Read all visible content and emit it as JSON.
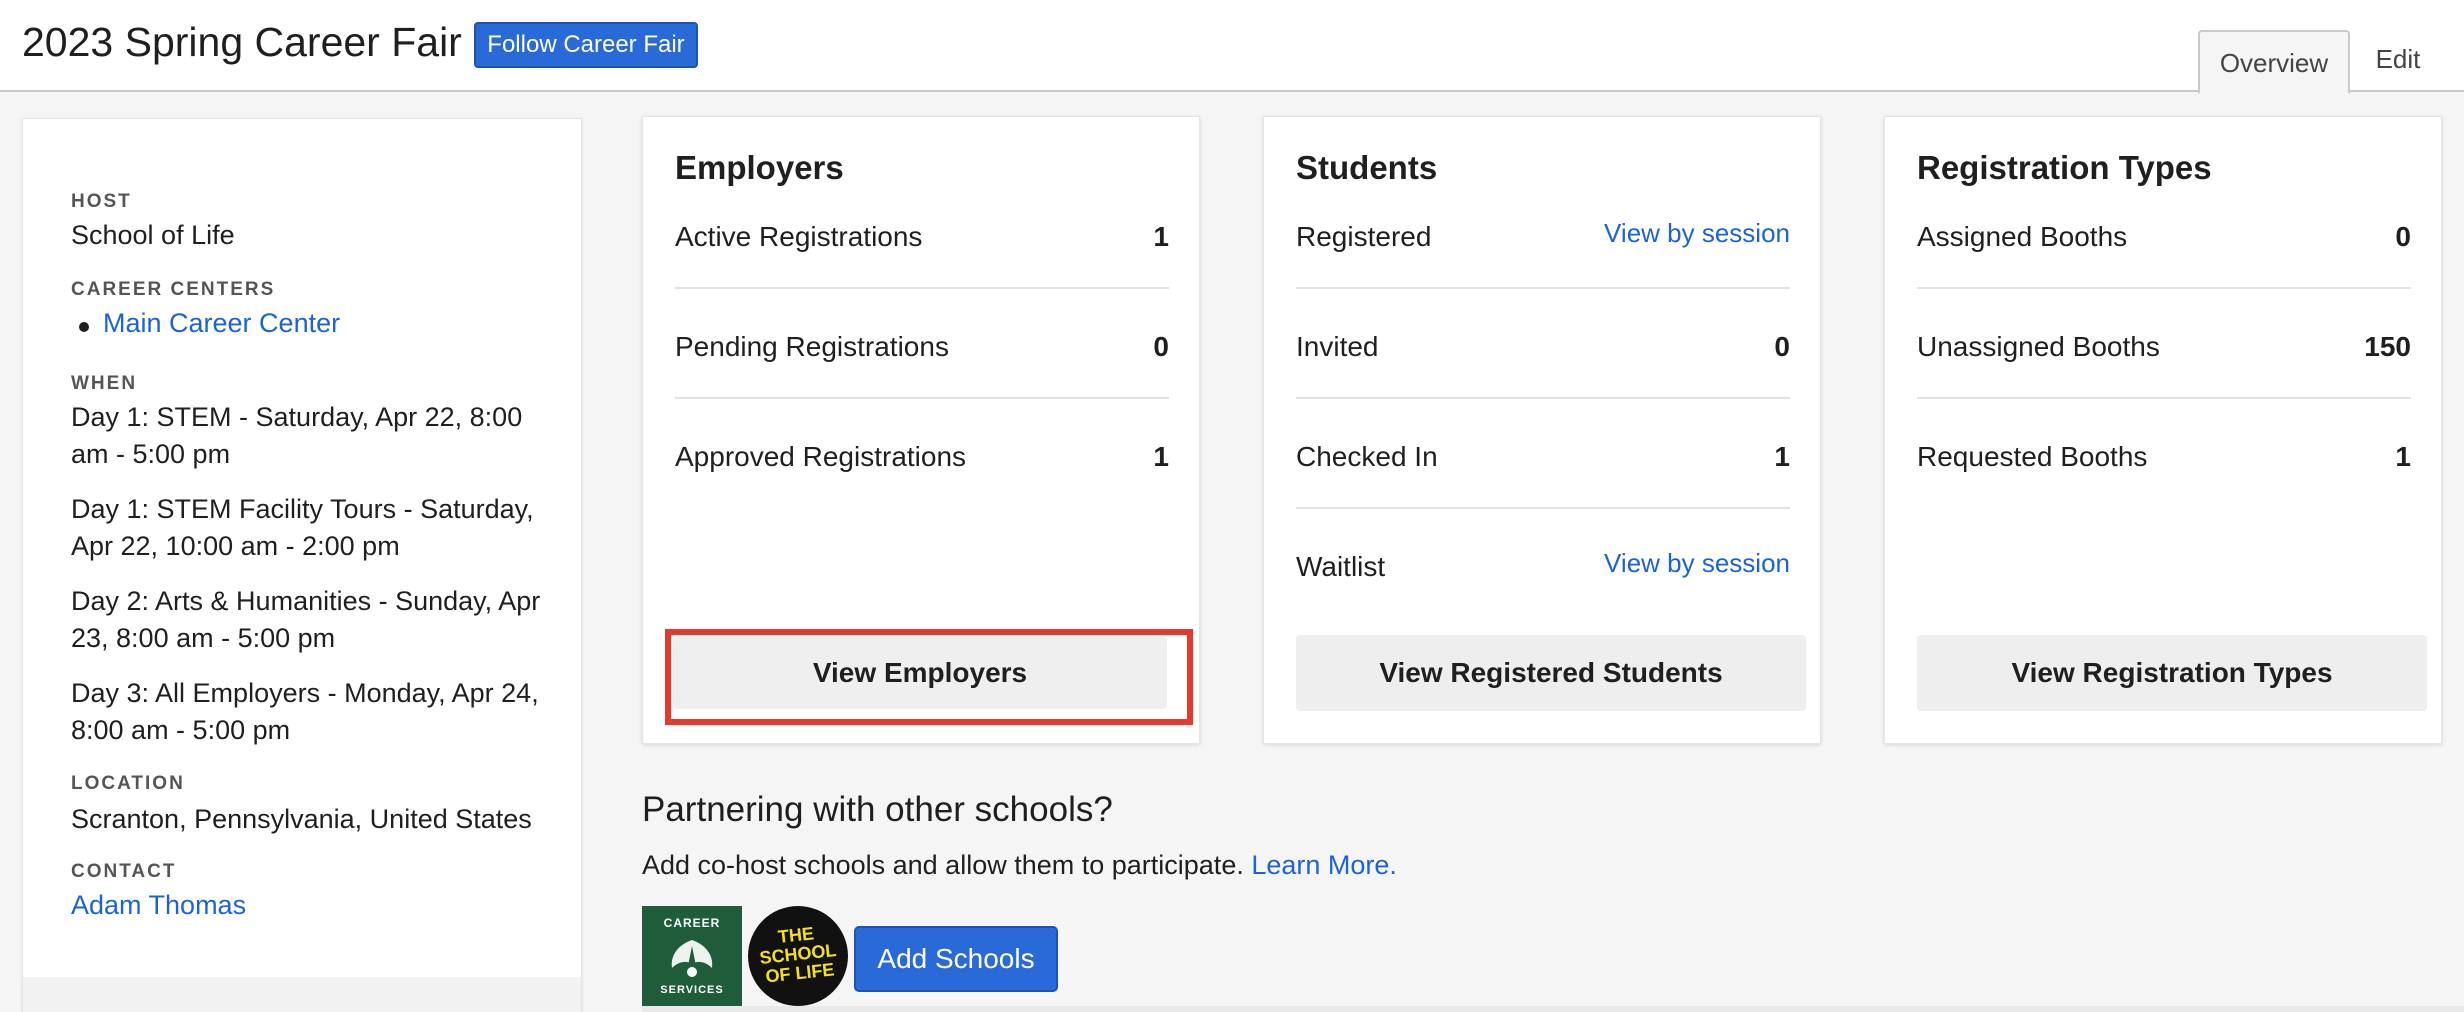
{
  "header": {
    "title": "2023 Spring Career Fair",
    "follow_label": "Follow Career Fair",
    "tabs": [
      {
        "label": "Overview",
        "active": true
      },
      {
        "label": "Edit",
        "active": false
      }
    ]
  },
  "info": {
    "host_label": "HOST",
    "host_value": "School of Life",
    "centers_label": "CAREER CENTERS",
    "centers": [
      "Main Career Center"
    ],
    "when_label": "WHEN",
    "when": [
      "Day 1: STEM - Saturday, Apr 22, 8:00 am - 5:00 pm",
      "Day 1: STEM Facility Tours - Saturday, Apr 22, 10:00 am - 2:00 pm",
      "Day 2: Arts & Humanities - Sunday, Apr 23, 8:00 am - 5:00 pm",
      "Day 3: All Employers - Monday, Apr 24, 8:00 am - 5:00 pm"
    ],
    "location_label": "LOCATION",
    "location_value": "Scranton, Pennsylvania, United States",
    "contact_label": "CONTACT",
    "contact_value": "Adam Thomas"
  },
  "employers": {
    "title": "Employers",
    "rows": [
      {
        "label": "Active Registrations",
        "value": "1"
      },
      {
        "label": "Pending Registrations",
        "value": "0"
      },
      {
        "label": "Approved Registrations",
        "value": "1"
      }
    ],
    "button": "View Employers"
  },
  "students": {
    "title": "Students",
    "rows": [
      {
        "label": "Registered",
        "link": "View by session"
      },
      {
        "label": "Invited",
        "value": "0"
      },
      {
        "label": "Checked In",
        "value": "1"
      },
      {
        "label": "Waitlist",
        "link": "View by session"
      }
    ],
    "button": "View Registered Students"
  },
  "registration_types": {
    "title": "Registration Types",
    "rows": [
      {
        "label": "Assigned Booths",
        "value": "0"
      },
      {
        "label": "Unassigned Booths",
        "value": "150"
      },
      {
        "label": "Requested Booths",
        "value": "1"
      }
    ],
    "button": "View Registration Types"
  },
  "partnering": {
    "title": "Partnering with other schools?",
    "text": "Add co-host schools and allow them to participate.",
    "learn_more": "Learn More.",
    "add_button": "Add Schools",
    "logo_career_top": "CAREER",
    "logo_career_bottom": "SERVICES",
    "logo_school_lines": [
      "THE",
      "SCHOOL",
      "OF LIFE"
    ]
  },
  "colors": {
    "accent": "#2a6ad8",
    "link": "#1b63d6",
    "highlight": "#e33a2c",
    "career_logo": "#1e5c3a"
  }
}
